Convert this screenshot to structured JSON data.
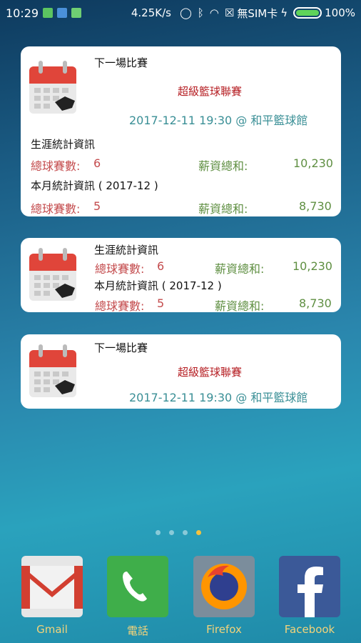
{
  "status_bar": {
    "time": "10:29",
    "speed": "4.25K/s",
    "sim": "無SIM卡",
    "battery": "100%"
  },
  "widgets": {
    "full": {
      "next_title": "下一場比賽",
      "league": "超級籃球聯賽",
      "match": "2017-12-11 19:30 @ 和平籃球館",
      "career_title": "生涯統計資訊",
      "career_games_label": "總球賽數:",
      "career_games": "6",
      "career_salary_label": "薪資總和:",
      "career_salary": "10,230",
      "month_title": "本月統計資訊 ( 2017-12 )",
      "month_games_label": "總球賽數:",
      "month_games": "5",
      "month_salary_label": "薪資總和:",
      "month_salary": "8,730"
    },
    "stats": {
      "career_title": "生涯統計資訊",
      "career_games_label": "總球賽數:",
      "career_games": "6",
      "career_salary_label": "薪資總和:",
      "career_salary": "10,230",
      "month_title": "本月統計資訊 ( 2017-12 )",
      "month_games_label": "總球賽數:",
      "month_games": "5",
      "month_salary_label": "薪資總和:",
      "month_salary": "8,730"
    },
    "next": {
      "next_title": "下一場比賽",
      "league": "超級籃球聯賽",
      "match": "2017-12-11 19:30 @ 和平籃球館"
    }
  },
  "dock": [
    {
      "label": "Gmail",
      "icon": "gmail-icon"
    },
    {
      "label": "電話",
      "icon": "phone-icon"
    },
    {
      "label": "Firefox",
      "icon": "firefox-icon"
    },
    {
      "label": "Facebook",
      "icon": "facebook-icon"
    }
  ],
  "page_indicator": {
    "count": 4,
    "active": 4
  },
  "colors": {
    "league_red": "#b51d22",
    "match_teal": "#3a8f96",
    "label_red": "#c44c4e",
    "value_green": "#5f8f42",
    "dock_label": "#f3d37a"
  }
}
